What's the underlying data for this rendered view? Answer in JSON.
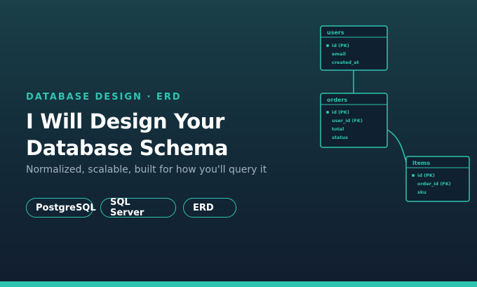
{
  "eyebrow": "DATABASE DESIGN · ERD",
  "title": {
    "line1": "I Will Design Your",
    "line2": "Database Schema"
  },
  "subtitle": "Normalized, scalable, built for how you'll query it",
  "tags": [
    "PostgreSQL",
    "SQL Server",
    "ERD"
  ],
  "erd": {
    "tables": [
      {
        "name": "users",
        "fields": [
          "id (PK)",
          "email",
          "created_at"
        ]
      },
      {
        "name": "orders",
        "fields": [
          "id (PK)",
          "user_id (FK)",
          "total",
          "status"
        ]
      },
      {
        "name": "items",
        "fields": [
          "id (PK)",
          "order_id (FK)",
          "sku"
        ]
      }
    ]
  },
  "colors": {
    "accent": "#2ec4b0",
    "background_top": "#1a4049",
    "background_bottom": "#111d2e",
    "text": "#ffffff",
    "muted": "#9fb3bd"
  }
}
